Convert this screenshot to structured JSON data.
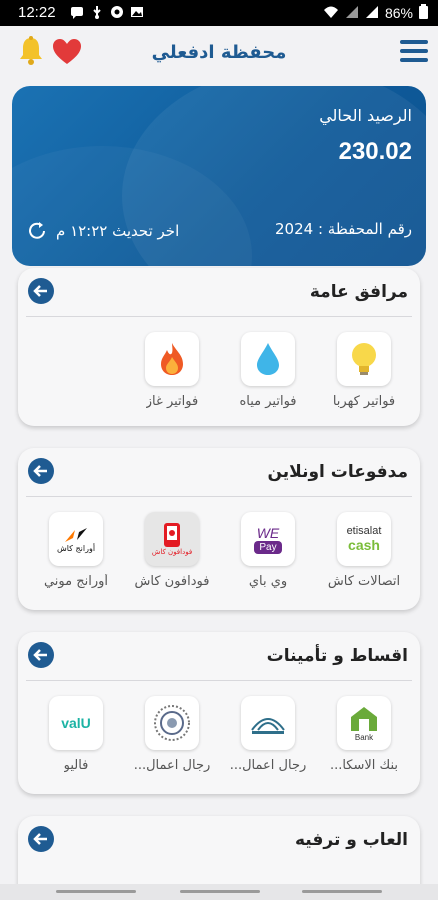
{
  "status_bar": {
    "time": "12:22",
    "battery": "86%",
    "left_icons": [
      "message-icon",
      "usb-icon",
      "vpn-icon",
      "gallery-icon"
    ],
    "right_icons": [
      "wifi-icon",
      "signal-x-icon",
      "signal-icon",
      "battery-icon"
    ]
  },
  "app_bar": {
    "title": "محفظة ادفعلي",
    "icons": [
      "bell-icon",
      "heart-icon",
      "menu-icon"
    ]
  },
  "balance_card": {
    "label": "الرصيد الحالي",
    "amount": "230.02",
    "wallet_number": "رقم المحفظة : 2024",
    "last_update": "اخر تحديث ١٢:٢٢ م"
  },
  "sections": [
    {
      "title": "مرافق عامة",
      "items": [
        {
          "label": "فواتير كهربا",
          "icon": "lightbulb-icon"
        },
        {
          "label": "فواتير مياه",
          "icon": "water-drop-icon"
        },
        {
          "label": "فواتير غاز",
          "icon": "flame-icon"
        }
      ]
    },
    {
      "title": "مدفوعات اونلاين",
      "items": [
        {
          "label": "اتصالات كاش",
          "icon": "etisalat-cash-logo",
          "logo_top": "etisalat",
          "logo_bottom": "cash"
        },
        {
          "label": "وي باي",
          "icon": "we-pay-logo",
          "logo_top": "WE",
          "logo_bottom": "Pay"
        },
        {
          "label": "فودافون كاش",
          "icon": "vodafone-cash-logo",
          "logo_text": "فودافون كاش"
        },
        {
          "label": "أورانج موني",
          "icon": "orange-money-logo",
          "logo_text": "أورانج كاش"
        }
      ]
    },
    {
      "title": "اقساط و تأمينات",
      "items": [
        {
          "label": "بنك الاسكا...",
          "icon": "housing-bank-logo",
          "logo_text": "Bank"
        },
        {
          "label": "رجال اعمال...",
          "icon": "business-men-logo"
        },
        {
          "label": "رجال اعمال...",
          "icon": "business-seal-logo"
        },
        {
          "label": "فاليو",
          "icon": "valu-logo",
          "logo_text": "valU"
        }
      ]
    },
    {
      "title": "العاب و ترفيه",
      "items": []
    }
  ],
  "colors": {
    "primary": "#1f5b92",
    "card": "#0e5a99",
    "background": "#f2f2f4"
  }
}
